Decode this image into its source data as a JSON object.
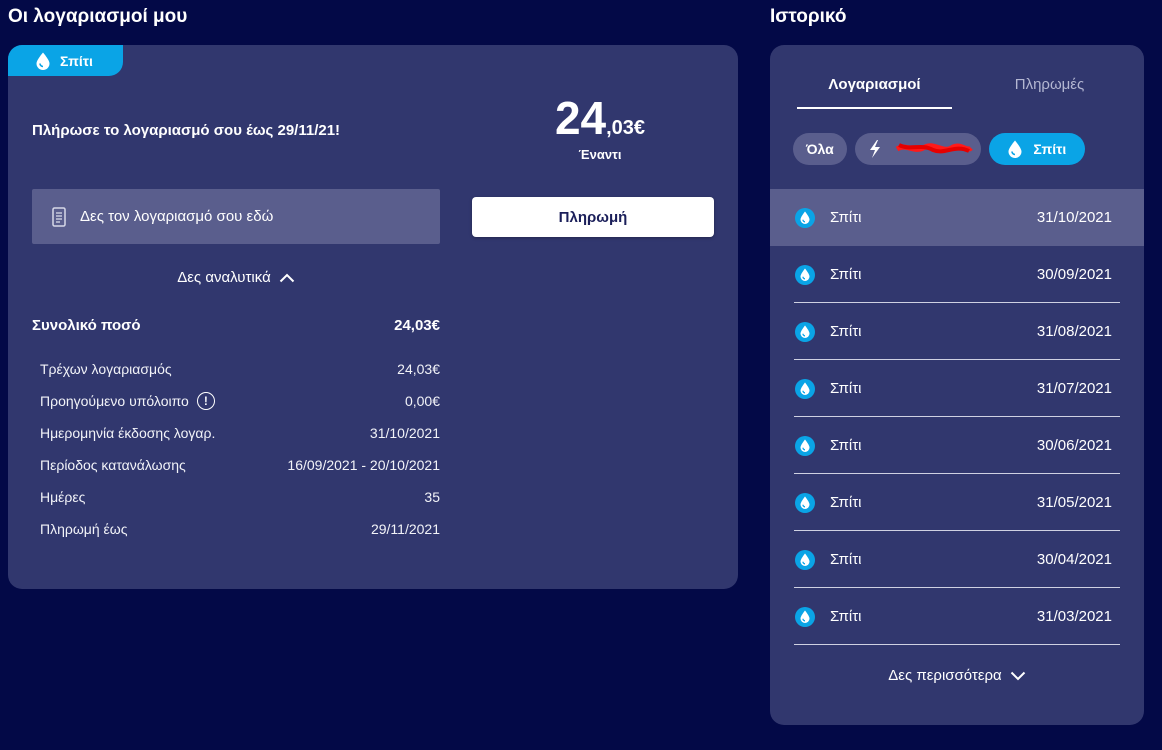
{
  "accounts": {
    "title": "Οι λογαριασμοί μου",
    "tag_label": "Σπίτι",
    "pay_prompt": "Πλήρωσε το λογαριασμό σου έως 29/11/21!",
    "amount_int": "24",
    "amount_dec": ",03€",
    "amount_sub": "Έναντι",
    "view_bill_label": "Δες τον λογαριασμό σου εδώ",
    "pay_button_label": "Πληρωμή",
    "details_toggle_label": "Δες αναλυτικά",
    "total_label": "Συνολικό ποσό",
    "total_value": "24,03€",
    "details": [
      {
        "label": "Τρέχων λογαριασμός",
        "value": "24,03€"
      },
      {
        "label": "Προηγούμενο υπόλοιπο",
        "value": "0,00€",
        "info": "!"
      },
      {
        "label": "Ημερομηνία έκδοσης λογαρ.",
        "value": "31/10/2021"
      },
      {
        "label": "Περίοδος κατανάλωσης",
        "value": "16/09/2021 - 20/10/2021"
      },
      {
        "label": "Ημέρες",
        "value": "35"
      },
      {
        "label": "Πληρωμή έως",
        "value": "29/11/2021"
      }
    ]
  },
  "history": {
    "title": "Ιστορικό",
    "tabs": [
      {
        "label": "Λογαριασμοί",
        "active": true
      },
      {
        "label": "Πληρωμές",
        "active": false
      }
    ],
    "filters": {
      "all_label": "Όλα",
      "active_label": "Σπίτι"
    },
    "rows": [
      {
        "label": "Σπίτι",
        "date": "31/10/2021"
      },
      {
        "label": "Σπίτι",
        "date": "30/09/2021"
      },
      {
        "label": "Σπίτι",
        "date": "31/08/2021"
      },
      {
        "label": "Σπίτι",
        "date": "31/07/2021"
      },
      {
        "label": "Σπίτι",
        "date": "30/06/2021"
      },
      {
        "label": "Σπίτι",
        "date": "31/05/2021"
      },
      {
        "label": "Σπίτι",
        "date": "30/04/2021"
      },
      {
        "label": "Σπίτι",
        "date": "31/03/2021"
      }
    ],
    "see_more_label": "Δες περισσότερα"
  },
  "colors": {
    "background": "#030947",
    "card": "#31376e",
    "accent": "#0aa4e6",
    "highlight": "#5a5e8d"
  }
}
